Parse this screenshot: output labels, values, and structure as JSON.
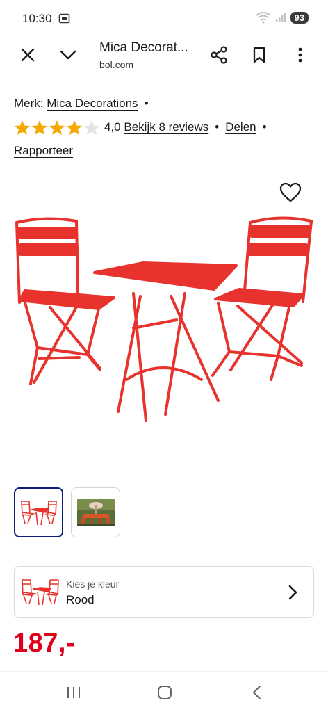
{
  "status": {
    "time": "10:30",
    "battery": "93"
  },
  "browser": {
    "title": "Mica Decorat...",
    "url": "bol.com"
  },
  "product": {
    "brand_prefix": "Merk:",
    "brand": "Mica Decorations",
    "rating": "4,0",
    "rating_value": 4.0,
    "rating_max": 5,
    "reviews_link": "Bekijk 8 reviews",
    "share_link": "Delen",
    "report_link": "Rapporteer",
    "separator": "•"
  },
  "color_picker": {
    "label": "Kies je kleur",
    "value": "Rood"
  },
  "price": "187,-",
  "colors": {
    "accent_red": "#e8322e",
    "price_red": "#e0001a",
    "star_gold": "#f5a800",
    "thumb_border": "#0a1e7a"
  },
  "icons": [
    "wifi-icon",
    "signal-icon",
    "cast-icon",
    "close-icon",
    "chevron-down-icon",
    "share-icon",
    "bookmark-icon",
    "more-icon",
    "star-icon",
    "heart-icon",
    "chevron-right-icon",
    "recent-apps-icon",
    "home-icon",
    "back-icon"
  ]
}
